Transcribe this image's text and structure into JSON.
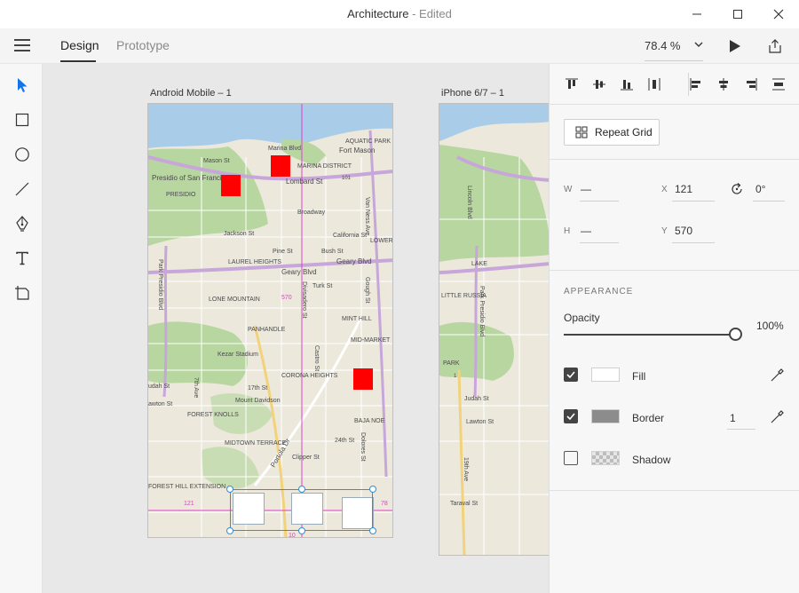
{
  "window": {
    "title": "Architecture",
    "title_suffix": " - Edited"
  },
  "toolbar": {
    "tabs": [
      {
        "label": "Design",
        "active": true
      },
      {
        "label": "Prototype",
        "active": false
      }
    ],
    "zoom": "78.4 %"
  },
  "tools": [
    "select-tool",
    "rectangle-tool",
    "ellipse-tool",
    "line-tool",
    "pen-tool",
    "text-tool",
    "artboard-tool"
  ],
  "canvas": {
    "artboards": [
      {
        "label": "Android Mobile – 1"
      },
      {
        "label": "iPhone 6/7 – 1"
      }
    ],
    "map_labels_1": [
      "AQUATIC PARK",
      "Marina Blvd",
      "Fort Mason",
      "MARINA DISTRICT",
      "Mason St",
      "Presidio of San Francisco",
      "Lombard St",
      "101",
      "PRESIDIO",
      "Broadway",
      "Van Ness Ave",
      "California St",
      "Jackson St",
      "Pine St",
      "Bush St",
      "LOWER",
      "LAUREL HEIGHTS",
      "Geary Blvd",
      "Geary Blvd",
      "Turk St",
      "Park Presidio Blvd",
      "LONE MOUNTAIN",
      "570",
      "Divisadero St",
      "Gough St",
      "MINT HILL",
      "PANHANDLE",
      "MID-MARKET",
      "Kezar Stadium",
      "Castro St",
      "CORONA HEIGHTS",
      "7th Ave",
      "17th St",
      "udah St",
      "awton St",
      "FOREST KNOLLS",
      "Mount Davidson",
      "MIDTOWN TERRACE",
      "Portola Dr",
      "Clipper St",
      "24th St",
      "BAJA NOE",
      "Dolores St",
      "FOREST HILL EXTENSION",
      "121",
      "78",
      "10"
    ],
    "map_labels_2": [
      "Lincoln Blvd",
      "LAKE",
      "LITTLE RUSSIA",
      "Park Presidio Blvd",
      "PARK",
      "1",
      "Judah St",
      "Lawton St",
      "19th Ave",
      "Taraval St"
    ]
  },
  "panel": {
    "repeat_grid_label": "Repeat Grid",
    "transform": {
      "w_label": "W",
      "w_value": "—",
      "h_label": "H",
      "h_value": "—",
      "x_label": "X",
      "x_value": "121",
      "y_label": "Y",
      "y_value": "570",
      "rotation_value": "0°"
    },
    "appearance": {
      "heading": "APPEARANCE",
      "opacity_label": "Opacity",
      "opacity_value": "100%",
      "opacity_fraction": 1.0,
      "fill_label": "Fill",
      "fill_checked": true,
      "fill_color": "#ffffff",
      "border_label": "Border",
      "border_checked": true,
      "border_color": "#8c8c8c",
      "border_width": "1",
      "shadow_label": "Shadow",
      "shadow_checked": false
    }
  },
  "colors": {
    "accent": "#2f8fd8",
    "red_shape": "#ff0000",
    "guide": "#e040c8"
  }
}
